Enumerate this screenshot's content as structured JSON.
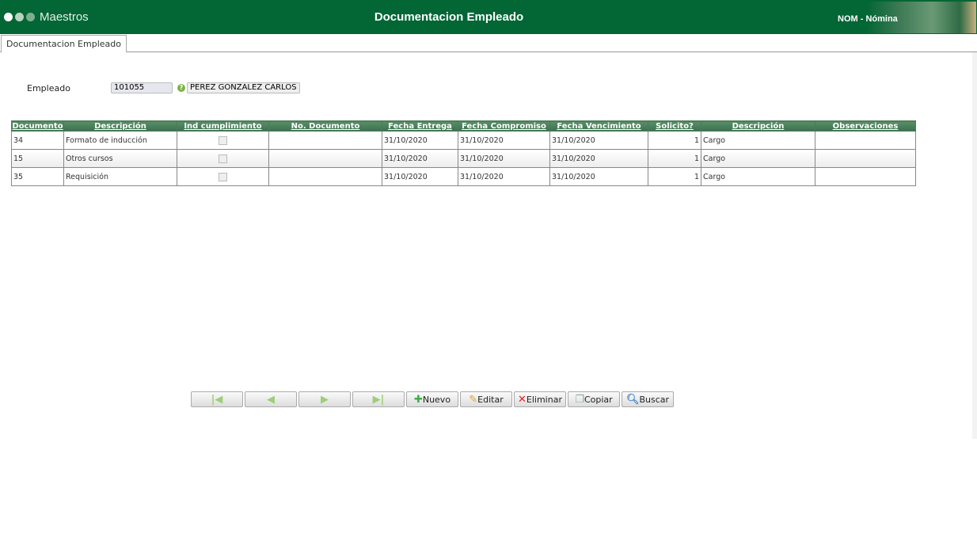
{
  "header": {
    "app": "Maestros",
    "title": "Documentacion Empleado",
    "module": "NOM - Nómina"
  },
  "tab": "Documentacion Empleado",
  "employee": {
    "label": "Empleado",
    "code": "101055",
    "name": "PEREZ GONZALEZ CARLOS"
  },
  "table": {
    "columns": [
      "Documento",
      "Descripción",
      "Ind cumplimiento",
      "No. Documento",
      "Fecha Entrega",
      "Fecha Compromiso",
      "Fecha Vencimiento",
      "Solicito?",
      "Descripción",
      "Observaciones"
    ],
    "rows": [
      {
        "doc": "34",
        "desc": "Formato de inducción",
        "cumple": false,
        "no": "",
        "entrega": "31/10/2020",
        "compromiso": "31/10/2020",
        "vence": "31/10/2020",
        "solicito": "1",
        "desc2": "Cargo",
        "obs": ""
      },
      {
        "doc": "15",
        "desc": "Otros cursos",
        "cumple": false,
        "no": "",
        "entrega": "31/10/2020",
        "compromiso": "31/10/2020",
        "vence": "31/10/2020",
        "solicito": "1",
        "desc2": "Cargo",
        "obs": ""
      },
      {
        "doc": "35",
        "desc": "Requisición",
        "cumple": false,
        "no": "",
        "entrega": "31/10/2020",
        "compromiso": "31/10/2020",
        "vence": "31/10/2020",
        "solicito": "1",
        "desc2": "Cargo",
        "obs": ""
      }
    ]
  },
  "toolbar": {
    "nuevo": "Nuevo",
    "editar": "Editar",
    "eliminar": "Eliminar",
    "copiar": "Copiar",
    "buscar": "Buscar"
  }
}
